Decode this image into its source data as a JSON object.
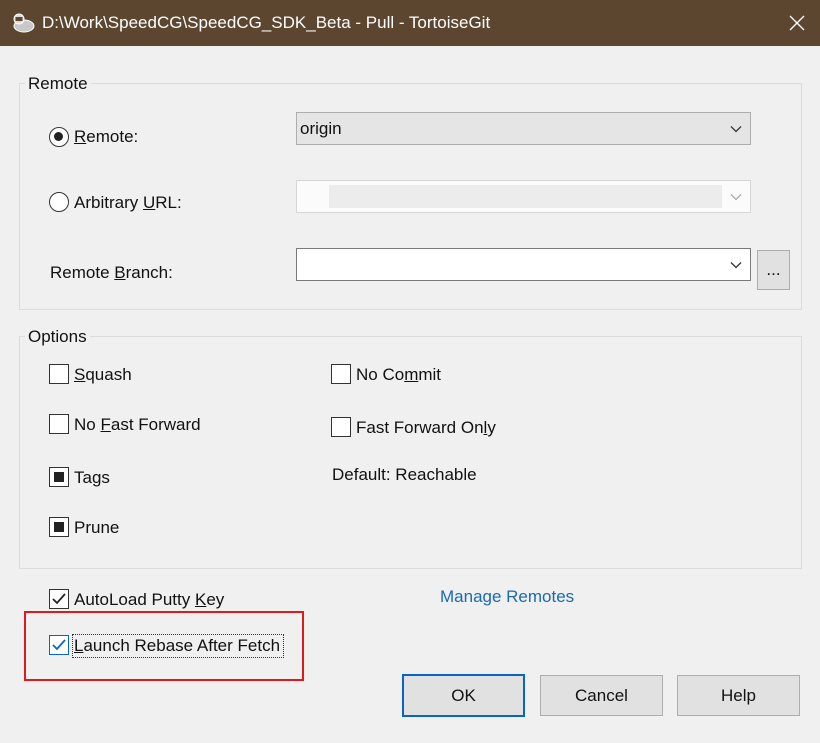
{
  "window": {
    "title": "D:\\Work\\SpeedCG\\SpeedCG_SDK_Beta - Pull - TortoiseGit",
    "close_icon": "close-icon",
    "app_icon": "tortoisegit-icon"
  },
  "remote_group": {
    "title": "Remote",
    "remote_radio": {
      "prefix": "",
      "mnemonic": "R",
      "rest": "emote:",
      "selected": true
    },
    "arbitrary_radio": {
      "prefix": "Arbitrary ",
      "mnemonic": "U",
      "rest": "RL:",
      "selected": false
    },
    "remote_value": "origin",
    "arbitrary_url_value": "",
    "branch_label": {
      "prefix": "Remote ",
      "mnemonic": "B",
      "rest": "ranch:"
    },
    "branch_value": "",
    "browse_label": "..."
  },
  "options_group": {
    "title": "Options",
    "squash": {
      "prefix": "",
      "mnemonic": "S",
      "rest": "quash",
      "state": "unchecked"
    },
    "no_fast_forward": {
      "prefix": "No ",
      "mnemonic": "F",
      "rest": "ast Forward",
      "state": "unchecked"
    },
    "tags": {
      "prefix": "",
      "mnemonic": "",
      "rest": "Tags",
      "state": "indeterminate"
    },
    "prune": {
      "prefix": "",
      "mnemonic": "",
      "rest": "Prune",
      "state": "indeterminate"
    },
    "no_commit": {
      "prefix": "No Co",
      "mnemonic": "m",
      "rest": "mit",
      "state": "unchecked"
    },
    "fast_forward_only": {
      "prefix": "Fast Forward On",
      "mnemonic": "l",
      "rest": "y",
      "state": "unchecked"
    },
    "default_text": "Default: Reachable"
  },
  "autoload_putty": {
    "prefix": "AutoLoad Putty ",
    "mnemonic": "K",
    "rest": "ey",
    "state": "checked"
  },
  "launch_rebase": {
    "prefix": "",
    "mnemonic": "L",
    "rest": "aunch Rebase After Fetch",
    "state": "checked"
  },
  "manage_remotes": "Manage Remotes",
  "buttons": {
    "ok": "OK",
    "cancel": "Cancel",
    "help": "Help"
  },
  "colors": {
    "titlebar": "#5c4630",
    "accent": "#0a64c8",
    "link": "#1a6ab0",
    "highlight": "#e01a1a"
  }
}
